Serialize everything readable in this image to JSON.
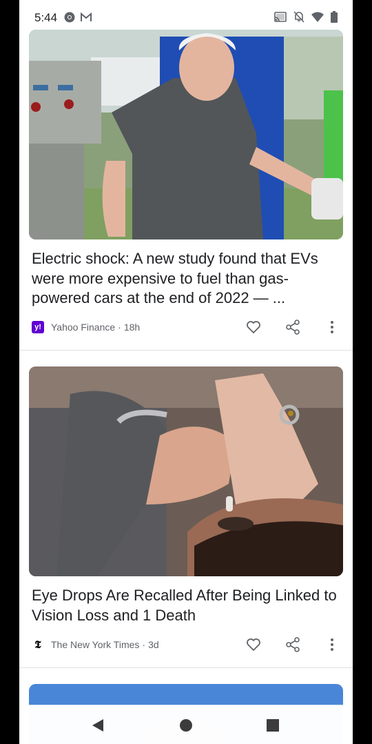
{
  "status_bar": {
    "time": "5:44",
    "left_icons": [
      "chrome-icon",
      "gmail-icon"
    ],
    "right_icons": [
      "cast-icon",
      "notifications-off-icon",
      "wifi-icon",
      "battery-icon"
    ]
  },
  "feed": {
    "cards": [
      {
        "title": "Electric shock: A new study found that EVs were more expensive to fuel than gas-powered cars at the end of 2022 — ...",
        "source": "Yahoo Finance",
        "source_logo": "y!",
        "source_color": "#6001d2",
        "separator": "·",
        "age": "18h",
        "image_icon": "ev-charging-photo"
      },
      {
        "title": "Eye Drops Are Recalled After Being Linked to Vision Loss and 1 Death",
        "source": "The New York Times",
        "source_logo": "𝕿",
        "source_color": "#000000",
        "separator": "·",
        "age": "3d",
        "image_icon": "eye-drops-photo"
      }
    ]
  },
  "navbar": {
    "buttons": [
      "back-icon",
      "home-icon",
      "recents-icon"
    ]
  }
}
